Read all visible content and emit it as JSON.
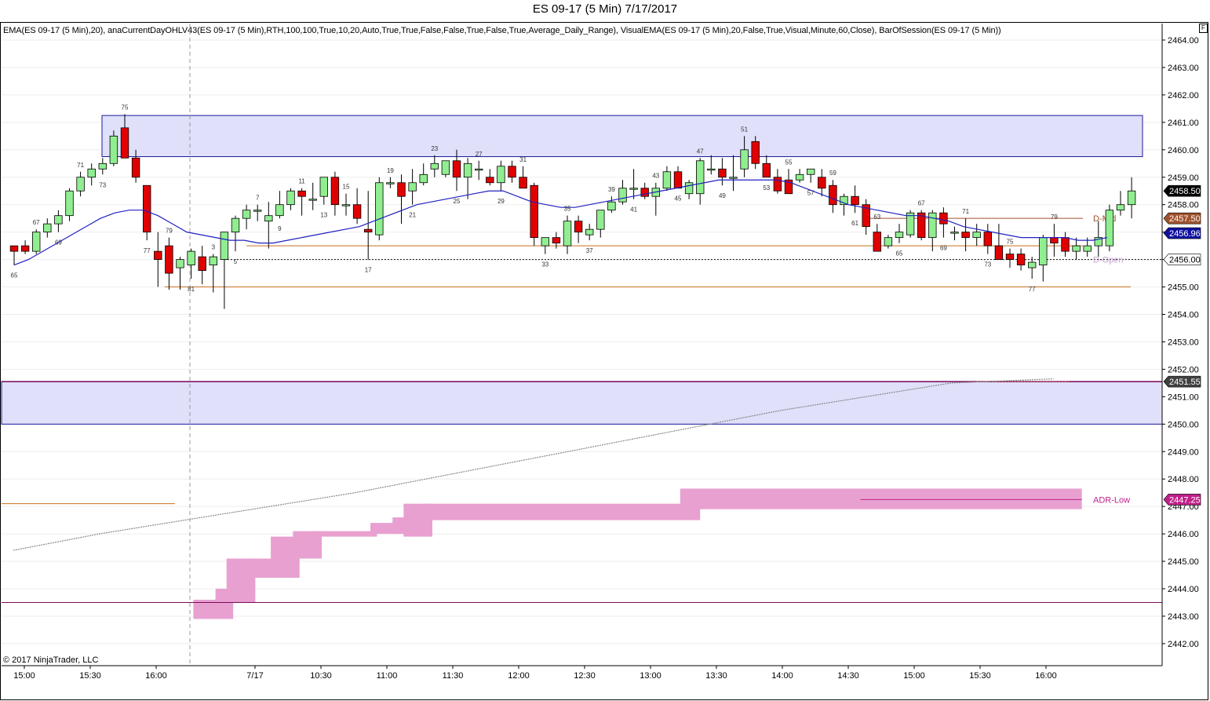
{
  "title": "ES 09-17 (5 Min)  7/17/2017",
  "indicators": "EMA(ES 09-17 (5 Min),20), anaCurrentDayOHLV43(ES 09-17 (5 Min),RTH,100,100,True,10,20,Auto,True,True,False,False,True,False,True,Average_Daily_Range), VisualEMA(ES 09-17 (5 Min),20,False,True,Visual,Minute,60,Close), BarOfSession(ES 09-17 (5 Min))",
  "corner_button": "F",
  "copyright": "© 2017 NinjaTrader, LLC",
  "colors": {
    "up_candle": "#90EE90",
    "down_candle": "#E00000",
    "ema": "#2020C0",
    "zone_fill": "#E0E0FA",
    "zone_border": "#1A1A9A",
    "adr_fill": "#E8A0D0",
    "dmid": "#A0522D",
    "dopen": "#C8A0D0",
    "level_orange": "#C87020"
  },
  "chart_data": {
    "type": "candlestick",
    "time_axis_labels": [
      "15:00",
      "15:30",
      "16:00",
      "7/17",
      "10:30",
      "11:00",
      "11:30",
      "12:00",
      "12:30",
      "13:00",
      "13:30",
      "14:00",
      "14:30",
      "15:00",
      "15:30",
      "16:00"
    ],
    "ylim": [
      2441.5,
      2464.5
    ],
    "y_ticks": [
      "2464.00",
      "2463.00",
      "2462.00",
      "2461.00",
      "2460.00",
      "2459.00",
      "2458.00",
      "2457.00",
      "2456.00",
      "2455.00",
      "2454.00",
      "2453.00",
      "2452.00",
      "2451.00",
      "2450.00",
      "2449.00",
      "2448.00",
      "2447.00",
      "2446.00",
      "2445.00",
      "2444.00",
      "2443.00",
      "2442.00"
    ],
    "candles": [
      [
        2456.5,
        2456.5,
        2455.8,
        2456.3
      ],
      [
        2456.5,
        2456.7,
        2456.2,
        2456.3
      ],
      [
        2456.3,
        2457.1,
        2456.2,
        2457.0
      ],
      [
        2457.0,
        2457.5,
        2456.8,
        2457.3
      ],
      [
        2457.3,
        2457.8,
        2457.0,
        2457.6
      ],
      [
        2457.6,
        2458.6,
        2457.4,
        2458.5
      ],
      [
        2458.5,
        2459.2,
        2458.3,
        2459.0
      ],
      [
        2459.0,
        2459.5,
        2458.7,
        2459.3
      ],
      [
        2459.3,
        2459.7,
        2459.1,
        2459.5
      ],
      [
        2459.5,
        2460.7,
        2459.4,
        2460.5
      ],
      [
        2460.8,
        2461.3,
        2459.7,
        2459.7
      ],
      [
        2459.7,
        2460.0,
        2458.8,
        2459.0
      ],
      [
        2458.7,
        2458.7,
        2456.7,
        2457.0
      ],
      [
        2456.3,
        2457.0,
        2455.0,
        2456.0
      ],
      [
        2456.5,
        2456.8,
        2454.9,
        2455.5
      ],
      [
        2455.7,
        2456.1,
        2454.9,
        2456.0
      ],
      [
        2455.8,
        2456.4,
        2455.3,
        2456.3
      ],
      [
        2456.1,
        2456.5,
        2455.1,
        2455.6
      ],
      [
        2455.8,
        2456.2,
        2454.8,
        2456.1
      ],
      [
        2456.0,
        2457.0,
        2454.2,
        2457.0
      ],
      [
        2457.0,
        2457.6,
        2456.3,
        2457.5
      ],
      [
        2457.5,
        2458.0,
        2457.1,
        2457.8
      ],
      [
        2457.8,
        2458.0,
        2457.4,
        2457.8
      ],
      [
        2457.4,
        2458.1,
        2456.4,
        2457.6
      ],
      [
        2457.6,
        2458.5,
        2457.5,
        2458.0
      ],
      [
        2458.0,
        2458.6,
        2457.8,
        2458.5
      ],
      [
        2458.5,
        2458.6,
        2457.6,
        2458.3
      ],
      [
        2458.2,
        2458.8,
        2457.8,
        2458.2
      ],
      [
        2458.3,
        2459.0,
        2458.0,
        2459.0
      ],
      [
        2459.0,
        2459.2,
        2457.6,
        2458.0
      ],
      [
        2458.0,
        2458.4,
        2457.6,
        2458.0
      ],
      [
        2458.0,
        2458.6,
        2457.3,
        2457.5
      ],
      [
        2457.1,
        2458.5,
        2456.0,
        2457.0
      ],
      [
        2456.9,
        2459.0,
        2456.7,
        2458.8
      ],
      [
        2458.8,
        2459.0,
        2458.6,
        2458.8
      ],
      [
        2458.8,
        2459.1,
        2457.3,
        2458.3
      ],
      [
        2458.5,
        2459.3,
        2458.0,
        2458.8
      ],
      [
        2458.8,
        2459.5,
        2458.7,
        2459.1
      ],
      [
        2459.3,
        2459.8,
        2459.0,
        2459.5
      ],
      [
        2459.1,
        2459.6,
        2459.0,
        2459.6
      ],
      [
        2459.6,
        2460.0,
        2458.5,
        2459.0
      ],
      [
        2459.0,
        2459.7,
        2458.2,
        2459.5
      ],
      [
        2459.3,
        2459.6,
        2458.9,
        2459.3
      ],
      [
        2459.0,
        2459.3,
        2458.7,
        2458.8
      ],
      [
        2458.8,
        2459.6,
        2458.5,
        2459.4
      ],
      [
        2459.4,
        2459.6,
        2458.8,
        2459.0
      ],
      [
        2459.0,
        2459.4,
        2458.6,
        2458.6
      ],
      [
        2458.7,
        2458.8,
        2456.5,
        2456.8
      ],
      [
        2456.5,
        2456.8,
        2456.2,
        2456.8
      ],
      [
        2456.8,
        2457.0,
        2456.4,
        2456.6
      ],
      [
        2456.5,
        2457.6,
        2456.2,
        2457.4
      ],
      [
        2457.4,
        2457.6,
        2456.6,
        2457.0
      ],
      [
        2456.9,
        2457.3,
        2456.7,
        2457.1
      ],
      [
        2457.1,
        2457.8,
        2456.8,
        2457.8
      ],
      [
        2457.8,
        2458.3,
        2457.7,
        2458.1
      ],
      [
        2458.1,
        2458.9,
        2458.0,
        2458.6
      ],
      [
        2458.6,
        2459.3,
        2458.2,
        2458.6
      ],
      [
        2458.6,
        2458.8,
        2458.2,
        2458.3
      ],
      [
        2458.3,
        2458.8,
        2457.6,
        2458.6
      ],
      [
        2458.6,
        2459.4,
        2458.5,
        2459.2
      ],
      [
        2459.2,
        2459.4,
        2458.6,
        2458.6
      ],
      [
        2458.4,
        2458.9,
        2458.2,
        2458.8
      ],
      [
        2458.4,
        2459.7,
        2458.0,
        2459.6
      ],
      [
        2459.3,
        2459.8,
        2459.1,
        2459.3
      ],
      [
        2459.3,
        2459.7,
        2458.7,
        2459.0
      ],
      [
        2459.0,
        2459.8,
        2458.5,
        2459.0
      ],
      [
        2459.3,
        2460.5,
        2459.0,
        2460.0
      ],
      [
        2460.3,
        2460.5,
        2459.3,
        2459.5
      ],
      [
        2459.5,
        2459.8,
        2459.0,
        2459.0
      ],
      [
        2459.0,
        2459.3,
        2458.4,
        2458.5
      ],
      [
        2458.9,
        2459.3,
        2458.4,
        2458.4
      ],
      [
        2458.9,
        2459.3,
        2458.8,
        2459.1
      ],
      [
        2459.1,
        2459.3,
        2458.8,
        2459.3
      ],
      [
        2459.0,
        2459.3,
        2458.3,
        2458.6
      ],
      [
        2458.7,
        2458.9,
        2457.7,
        2458.0
      ],
      [
        2458.0,
        2458.4,
        2457.6,
        2458.3
      ],
      [
        2458.3,
        2458.7,
        2457.7,
        2458.0
      ],
      [
        2458.0,
        2458.2,
        2456.9,
        2457.2
      ],
      [
        2457.0,
        2457.3,
        2456.4,
        2456.3
      ],
      [
        2456.5,
        2456.9,
        2456.4,
        2456.8
      ],
      [
        2456.8,
        2457.3,
        2456.6,
        2457.0
      ],
      [
        2456.9,
        2457.8,
        2456.8,
        2457.7
      ],
      [
        2457.7,
        2457.8,
        2456.7,
        2456.8
      ],
      [
        2456.8,
        2457.8,
        2456.3,
        2457.7
      ],
      [
        2457.7,
        2457.9,
        2456.8,
        2457.3
      ],
      [
        2457.0,
        2457.2,
        2456.7,
        2457.0
      ],
      [
        2457.0,
        2457.5,
        2456.3,
        2456.8
      ],
      [
        2456.8,
        2457.3,
        2456.5,
        2457.0
      ],
      [
        2457.0,
        2457.3,
        2456.2,
        2456.5
      ],
      [
        2456.5,
        2457.3,
        2456.0,
        2456.0
      ],
      [
        2456.2,
        2456.4,
        2455.7,
        2456.0
      ],
      [
        2456.2,
        2456.4,
        2455.6,
        2455.8
      ],
      [
        2455.7,
        2456.1,
        2455.3,
        2455.9
      ],
      [
        2455.8,
        2456.9,
        2455.2,
        2456.8
      ],
      [
        2456.8,
        2457.3,
        2456.1,
        2456.6
      ],
      [
        2456.8,
        2457.0,
        2456.1,
        2456.3
      ],
      [
        2456.3,
        2456.8,
        2456.0,
        2456.5
      ],
      [
        2456.3,
        2456.8,
        2456.1,
        2456.5
      ],
      [
        2456.5,
        2457.4,
        2456.1,
        2456.8
      ],
      [
        2456.5,
        2458.0,
        2456.3,
        2457.8
      ],
      [
        2457.8,
        2458.5,
        2457.6,
        2458.0
      ],
      [
        2458.0,
        2459.0,
        2457.5,
        2458.5
      ]
    ],
    "ema_values": [
      2455.8,
      2456.0,
      2456.3,
      2456.6,
      2456.9,
      2457.2,
      2457.5,
      2457.7,
      2457.8,
      2457.8,
      2457.6,
      2457.3,
      2457.0,
      2456.9,
      2456.8,
      2456.7,
      2456.7,
      2456.6,
      2456.6,
      2456.7,
      2456.8,
      2456.9,
      2457.0,
      2457.1,
      2457.2,
      2457.4,
      2457.6,
      2457.8,
      2458.0,
      2458.1,
      2458.2,
      2458.3,
      2458.4,
      2458.5,
      2458.5,
      2458.3,
      2458.1,
      2458.0,
      2457.9,
      2457.9,
      2458.0,
      2458.1,
      2458.2,
      2458.3,
      2458.4,
      2458.5,
      2458.6,
      2458.7,
      2458.8,
      2458.9,
      2458.9,
      2458.9,
      2458.9,
      2458.9,
      2458.8,
      2458.6,
      2458.4,
      2458.2,
      2458.0,
      2457.9,
      2457.8,
      2457.7,
      2457.6,
      2457.6,
      2457.5,
      2457.4,
      2457.2,
      2457.1,
      2457.0,
      2456.9,
      2456.8,
      2456.8,
      2456.8,
      2456.8,
      2456.7,
      2456.7,
      2456.8
    ],
    "bar_numbers": [
      "65",
      "67",
      "69",
      "71",
      "73",
      "75",
      "77",
      "79",
      "81",
      "3",
      "5",
      "7",
      "9",
      "11",
      "13",
      "15",
      "17",
      "19",
      "21",
      "23",
      "25",
      "27",
      "29",
      "31",
      "33",
      "35",
      "37",
      "39",
      "41",
      "43",
      "45",
      "47",
      "49",
      "51",
      "53",
      "55",
      "57",
      "59",
      "61",
      "63",
      "65",
      "67",
      "69",
      "71",
      "73",
      "75",
      "77",
      "79"
    ],
    "zones": [
      {
        "name": "upper-zone",
        "from": 2459.75,
        "to": 2461.25
      },
      {
        "name": "lower-zone",
        "from": 2450.0,
        "to": 2451.55
      }
    ],
    "levels": [
      {
        "label": "D-Mid",
        "value": 2457.5
      },
      {
        "label": "D-Open",
        "value": 2456.0
      },
      {
        "label": "ADR-Low",
        "value": 2447.25
      }
    ],
    "price_markers": [
      {
        "value": "2458.50",
        "bg": "#000000",
        "fg": "#FFFFFF"
      },
      {
        "value": "2457.50",
        "bg": "#A0522D",
        "fg": "#FFFFFF"
      },
      {
        "value": "2456.96",
        "bg": "#1010A0",
        "fg": "#FFFFFF"
      },
      {
        "value": "2456.00",
        "bg": "#FFFFFF",
        "fg": "#000000"
      },
      {
        "value": "2451.55",
        "bg": "#404040",
        "fg": "#FFFFFF"
      },
      {
        "value": "2447.25",
        "bg": "#C0208A",
        "fg": "#FFFFFF"
      }
    ]
  }
}
